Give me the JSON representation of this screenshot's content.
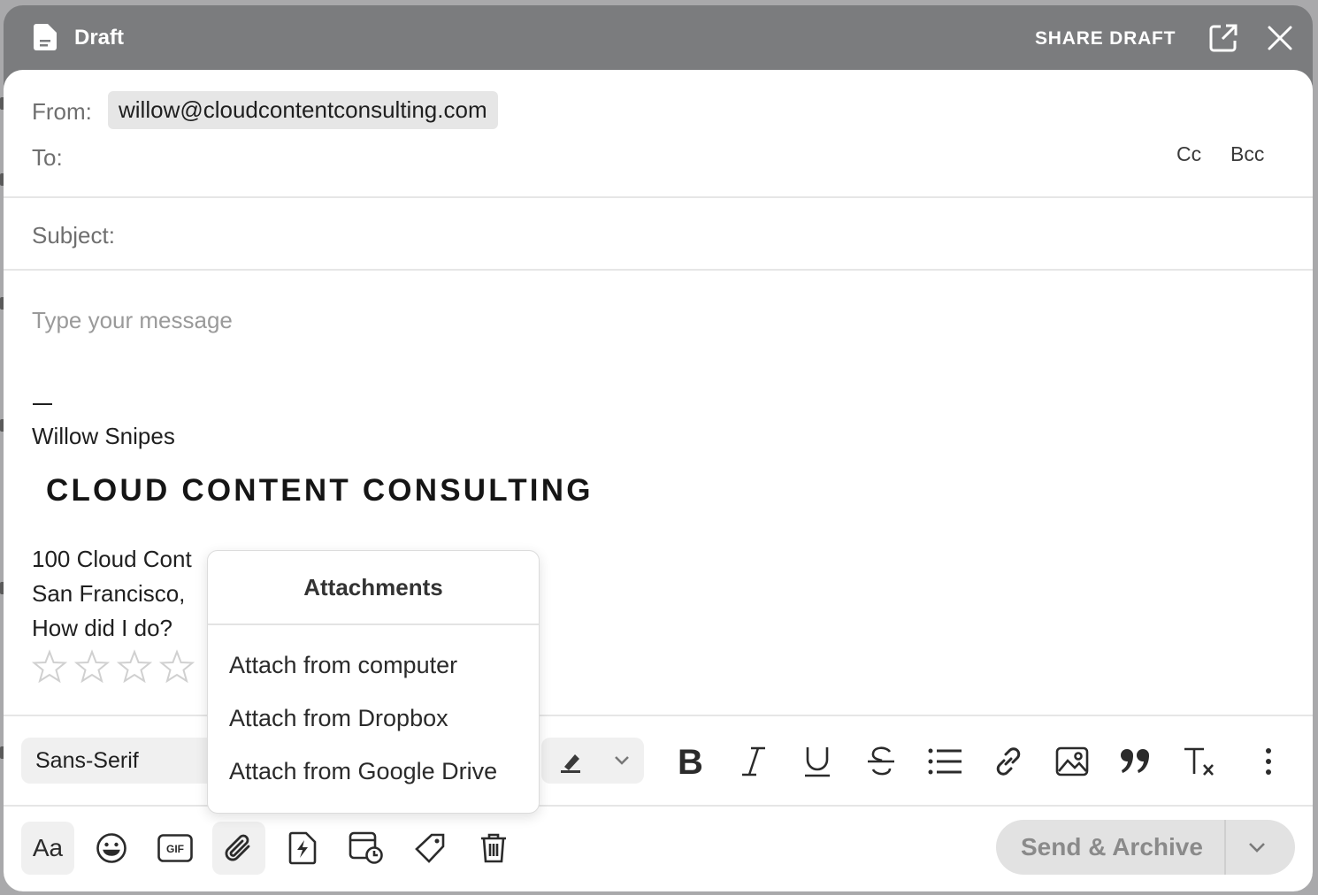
{
  "window": {
    "title": "Draft",
    "share_label": "SHARE DRAFT"
  },
  "header": {
    "from_label": "From:",
    "from_value": "willow@cloudcontentconsulting.com",
    "to_label": "To:",
    "cc_label": "Cc",
    "bcc_label": "Bcc",
    "subject_label": "Subject:"
  },
  "body": {
    "placeholder": "Type your message",
    "signature": {
      "name": "Willow Snipes",
      "logo_text": "CLOUD CONTENT CONSULTING",
      "address_line1": "100 Cloud Cont",
      "address_line2": "San Francisco,",
      "rating_prompt": "How did I do?"
    }
  },
  "format_toolbar": {
    "font_family": "Sans-Serif"
  },
  "attachments_menu": {
    "title": "Attachments",
    "items": [
      "Attach from computer",
      "Attach from Dropbox",
      "Attach from Google Drive"
    ]
  },
  "actions": {
    "text_format_label": "Aa",
    "send_label": "Send & Archive"
  },
  "colors": {
    "titlebar": "#7b7c7e",
    "chip": "#e6e6e6",
    "send_button": "#e2e2e2"
  }
}
